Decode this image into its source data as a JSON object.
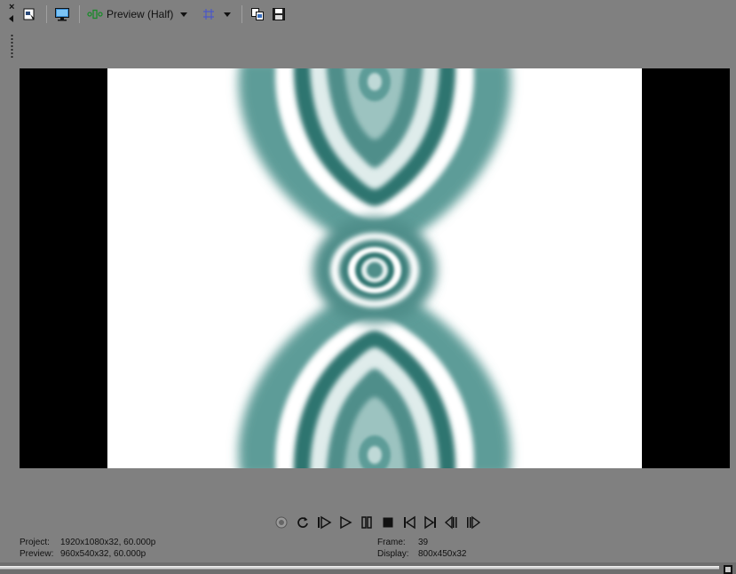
{
  "toolbar": {
    "dock_close": "×",
    "preview_quality_label": "Preview (Half)"
  },
  "status": {
    "project_label": "Project:",
    "project_value": "1920x1080x32, 60.000p",
    "preview_label": "Preview:",
    "preview_value": "960x540x32, 60.000p",
    "frame_label": "Frame:",
    "frame_value": "39",
    "display_label": "Display:",
    "display_value": "800x450x32"
  },
  "colors": {
    "panel": "#808080",
    "letterbox": "#000000",
    "video_bg": "#ffffff",
    "pattern_teal": "#2f7470"
  },
  "icons": {
    "toolbar": [
      "dock-close-icon",
      "dock-arrow-icon",
      "properties-icon",
      "external-monitor-icon",
      "split-screen-icon",
      "overlay-grid-icon",
      "copy-snapshot-icon",
      "save-snapshot-icon"
    ],
    "transport": [
      "record-icon",
      "loop-icon",
      "play-from-start-icon",
      "play-icon",
      "pause-icon",
      "stop-icon",
      "previous-frame-icon",
      "next-frame-icon",
      "go-to-start-icon",
      "go-to-end-icon"
    ]
  }
}
